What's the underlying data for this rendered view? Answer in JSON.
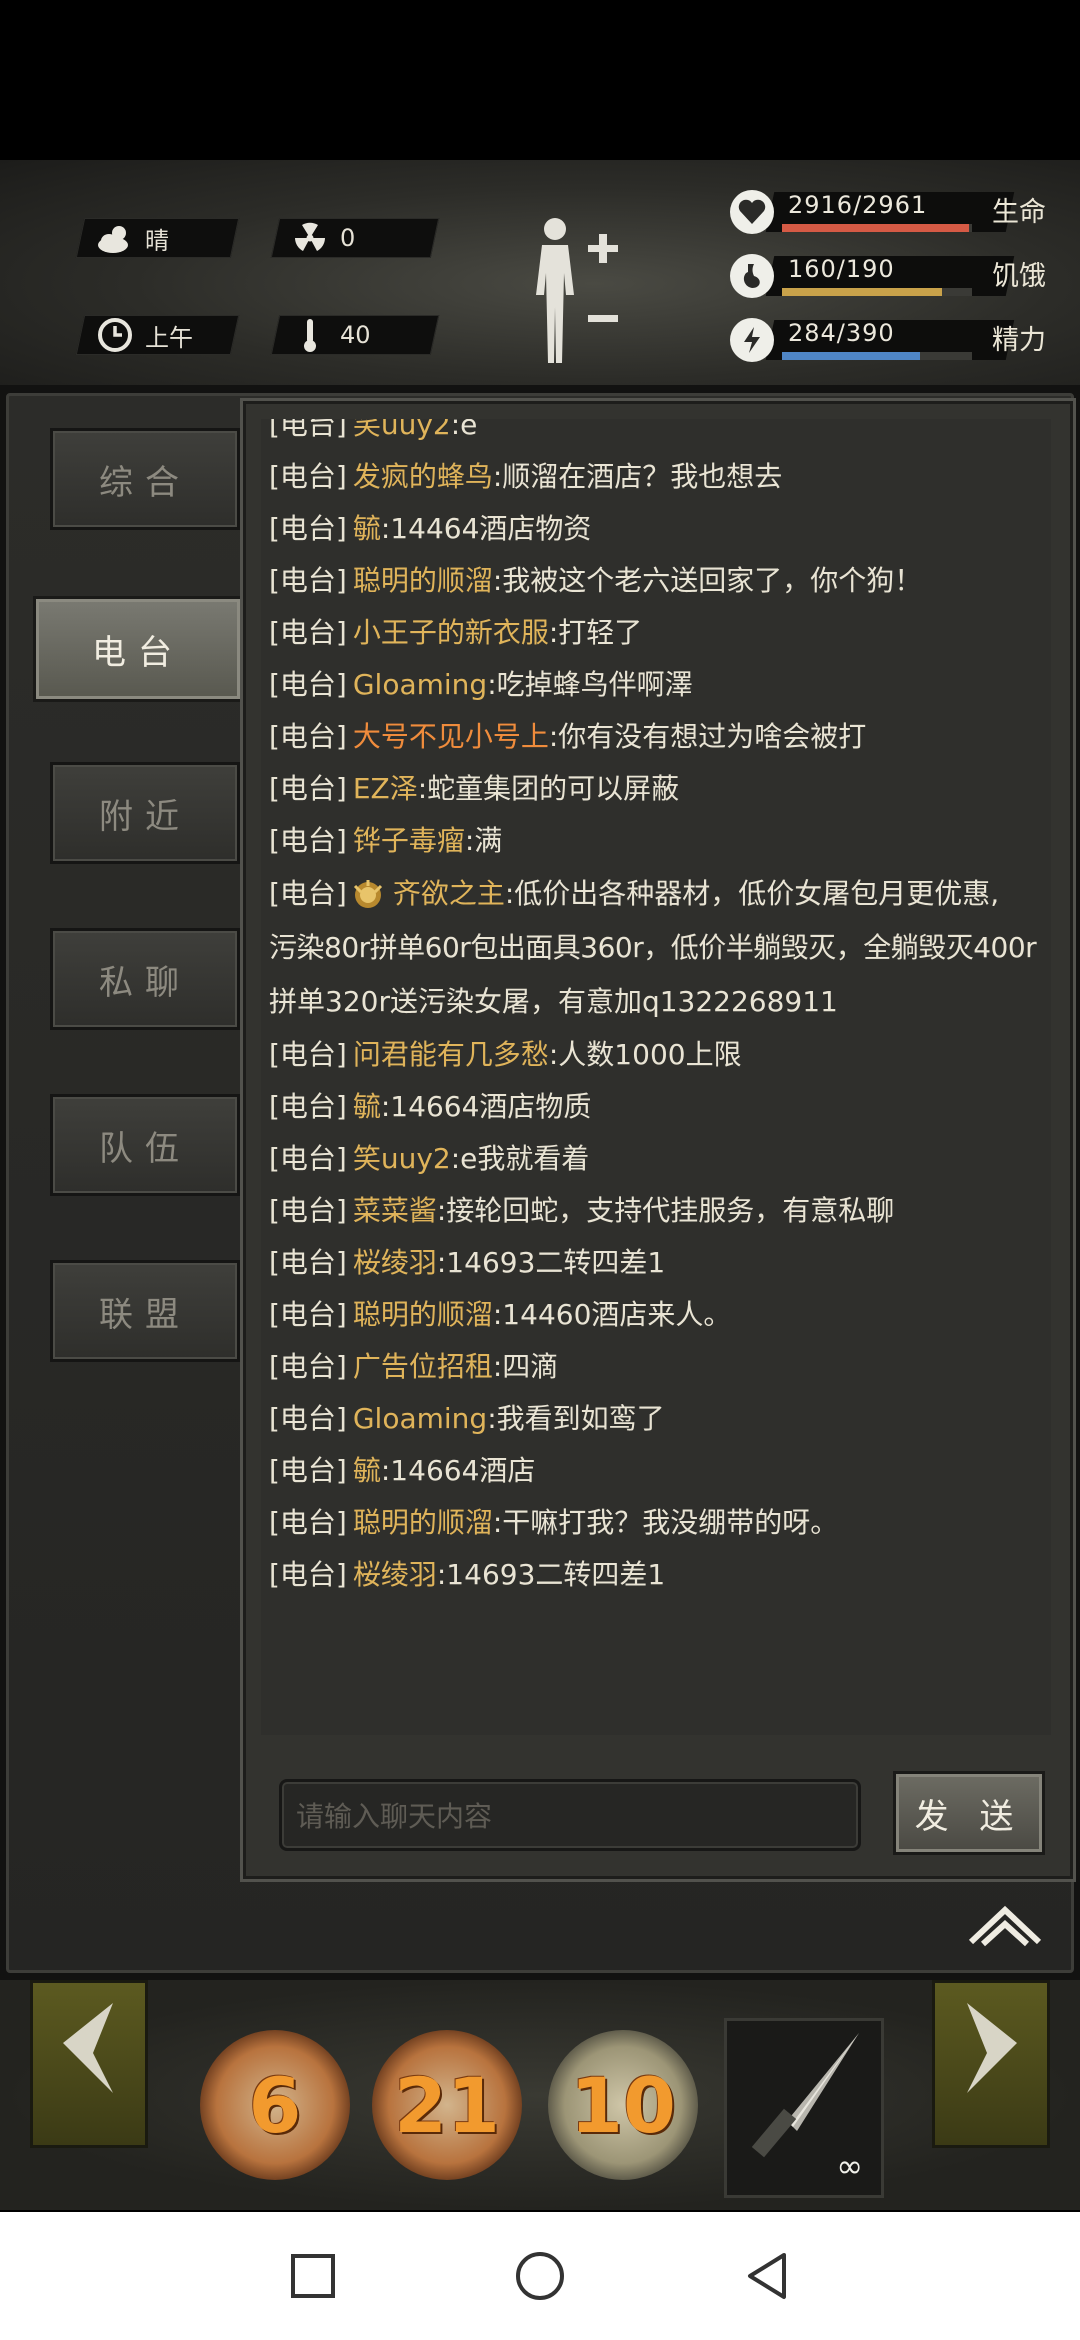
{
  "hud": {
    "weather": "晴",
    "radiation": "0",
    "time_of_day": "上午",
    "temperature": "40",
    "stats": [
      {
        "value": "2916/2961",
        "label": "生命",
        "fraction": 0.985,
        "color": "#d55a45",
        "icon": "heart-icon"
      },
      {
        "value": "160/190",
        "label": "饥饿",
        "fraction": 0.842,
        "color": "#c9a24a",
        "icon": "stomach-icon"
      },
      {
        "value": "284/390",
        "label": "精力",
        "fraction": 0.728,
        "color": "#4f86c6",
        "icon": "energy-icon"
      }
    ]
  },
  "tabs": [
    "综合",
    "电台",
    "附近",
    "私聊",
    "队伍",
    "联盟"
  ],
  "active_tab": "电台",
  "chat": {
    "partial_top": {
      "channel": "[电台]",
      "name": "笑uuy2",
      "text": ":e"
    },
    "messages": [
      {
        "channel": "[电台]",
        "name": "发疯的蜂鸟",
        "text": ":顺溜在酒店？我也想去"
      },
      {
        "channel": "[电台]",
        "name": "毓",
        "text": ":14464酒店物资"
      },
      {
        "channel": "[电台]",
        "name": "聪明的顺溜",
        "text": ":我被这个老六送回家了，你个狗！"
      },
      {
        "channel": "[电台]",
        "name": "小王子的新衣服",
        "text": ":打轻了"
      },
      {
        "channel": "[电台]",
        "name": "Gloaming",
        "text": ":吃掉蜂鸟伴啊澤"
      },
      {
        "channel": "[电台]",
        "name": "大号不见小号上",
        "text": ":你有没有想过为啥会被打",
        "orange": true
      },
      {
        "channel": "[电台]",
        "name": "EZ泽",
        "text": ":蛇童集团的可以屏蔽"
      },
      {
        "channel": "[电台]",
        "name": "铧子毒瘤",
        "text": ":满"
      }
    ],
    "long_message": {
      "channel": "[电台]",
      "name": "齐欲之主",
      "line1": ":低价出各种器材，低价女屠包月更优惠,",
      "line2": "污染80r拼单60r包出面具360r，低价半躺毁灭，全躺毁灭400r",
      "line3": "拼单320r送污染女屠，有意加q1322268911"
    },
    "messages2": [
      {
        "channel": "[电台]",
        "name": "问君能有几多愁",
        "text": ":人数1000上限"
      },
      {
        "channel": "[电台]",
        "name": "毓",
        "text": ":14664酒店物质"
      },
      {
        "channel": "[电台]",
        "name": "笑uuy2",
        "text": ":e我就看着"
      },
      {
        "channel": "[电台]",
        "name": "菜菜酱",
        "text": ":接轮回蛇，支持代挂服务，有意私聊"
      },
      {
        "channel": "[电台]",
        "name": "桜绫羽",
        "text": ":14693二转四差1"
      },
      {
        "channel": "[电台]",
        "name": "聪明的顺溜",
        "text": ":14460酒店来人。"
      },
      {
        "channel": "[电台]",
        "name": "广告位招租",
        "text": ":四滴"
      },
      {
        "channel": "[电台]",
        "name": "Gloaming",
        "text": ":我看到如鸾了"
      },
      {
        "channel": "[电台]",
        "name": "毓",
        "text": ":14664酒店"
      },
      {
        "channel": "[电台]",
        "name": "聪明的顺溜",
        "text": ":干嘛打我？我没绷带的呀。"
      },
      {
        "channel": "[电台]",
        "name": "桜绫羽",
        "text": ":14693二转四差1"
      }
    ],
    "input_placeholder": "请输入聊天内容",
    "send_label": "发 送"
  },
  "skills": [
    {
      "count": "6",
      "icon": "sprint-icon"
    },
    {
      "count": "21",
      "icon": "punch-icon"
    },
    {
      "count": "10",
      "icon": "heal-icon"
    }
  ],
  "weapon": {
    "icon": "knife-icon",
    "ammo": "∞"
  }
}
